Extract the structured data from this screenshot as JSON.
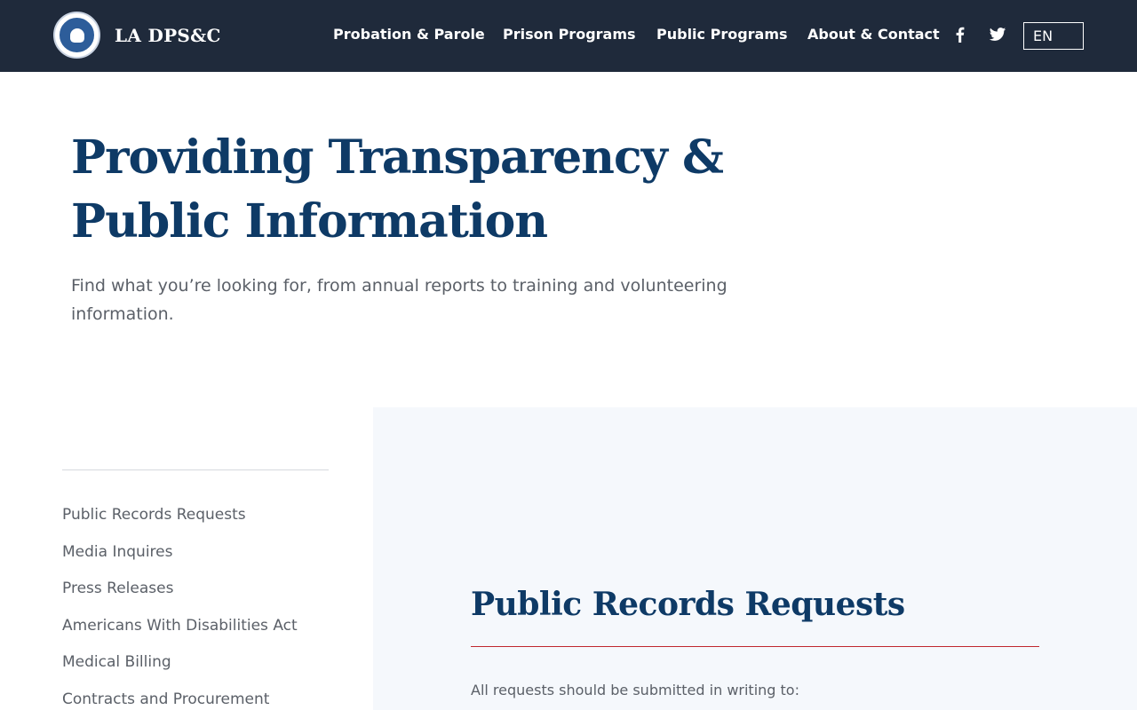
{
  "header": {
    "brand_name": "LA DPS&C",
    "nav": [
      {
        "label": "Probation & Parole"
      },
      {
        "label": "Prison Programs"
      },
      {
        "label": "Public Programs"
      },
      {
        "label": "About & Contact"
      }
    ],
    "social_icons": [
      "facebook-icon",
      "twitter-icon"
    ],
    "language": "EN"
  },
  "hero": {
    "title": "Providing Transparency & Public Information",
    "subtitle": "Find what you’re looking for, from annual reports to training and volunteering information."
  },
  "sidebar": {
    "items": [
      {
        "label": "Public Records Requests"
      },
      {
        "label": "Media Inquires"
      },
      {
        "label": "Press Releases"
      },
      {
        "label": "Americans With Disabilities Act"
      },
      {
        "label": "Medical Billing"
      },
      {
        "label": "Contracts and Procurement"
      }
    ]
  },
  "main": {
    "section_title": "Public Records Requests",
    "intro_text": "All requests should be submitted in writing to:"
  },
  "colors": {
    "topbar": "#1f2a3b",
    "heading": "#0e3a66",
    "accent_rule": "#c0282f",
    "panel_bg": "#f5f8fc"
  }
}
